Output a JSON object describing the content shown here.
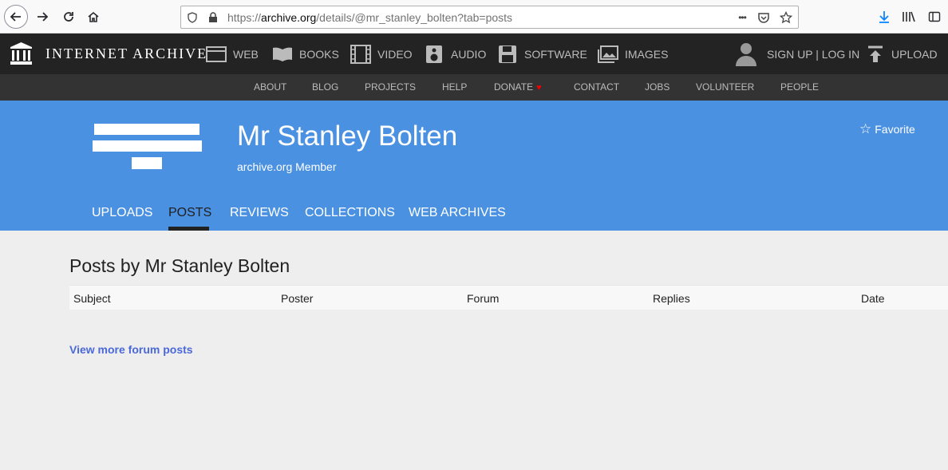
{
  "browser": {
    "url_prefix": "https://",
    "url_host": "archive.org",
    "url_path": "/details/@mr_stanley_bolten?tab=posts",
    "url_more": "•••"
  },
  "topnav": {
    "logo_text": "INTERNET ARCHIVE",
    "media": [
      {
        "label": "WEB",
        "icon": "web-icon"
      },
      {
        "label": "BOOKS",
        "icon": "books-icon"
      },
      {
        "label": "VIDEO",
        "icon": "video-icon"
      },
      {
        "label": "AUDIO",
        "icon": "audio-icon"
      },
      {
        "label": "SOFTWARE",
        "icon": "software-icon"
      },
      {
        "label": "IMAGES",
        "icon": "images-icon"
      }
    ],
    "signup_login": "SIGN UP | LOG IN",
    "upload": "UPLOAD"
  },
  "subnav": {
    "items": [
      "ABOUT",
      "BLOG",
      "PROJECTS",
      "HELP",
      "DONATE",
      "CONTACT",
      "JOBS",
      "VOLUNTEER",
      "PEOPLE"
    ],
    "heart": "♥"
  },
  "profile": {
    "name": "Mr Stanley Bolten",
    "role": "archive.org Member",
    "favorite": "Favorite",
    "favorite_star": "☆",
    "tabs": [
      "UPLOADS",
      "POSTS",
      "REVIEWS",
      "COLLECTIONS",
      "WEB ARCHIVES"
    ],
    "active_tab": "POSTS"
  },
  "content": {
    "title": "Posts by Mr Stanley Bolten",
    "columns": [
      "Subject",
      "Poster",
      "Forum",
      "Replies",
      "Date"
    ],
    "view_more": "View more forum posts"
  },
  "colors": {
    "header_blue": "#4b91e2",
    "topnav_bg": "#232323",
    "subnav_bg": "#333333",
    "link": "#4a68d8"
  }
}
